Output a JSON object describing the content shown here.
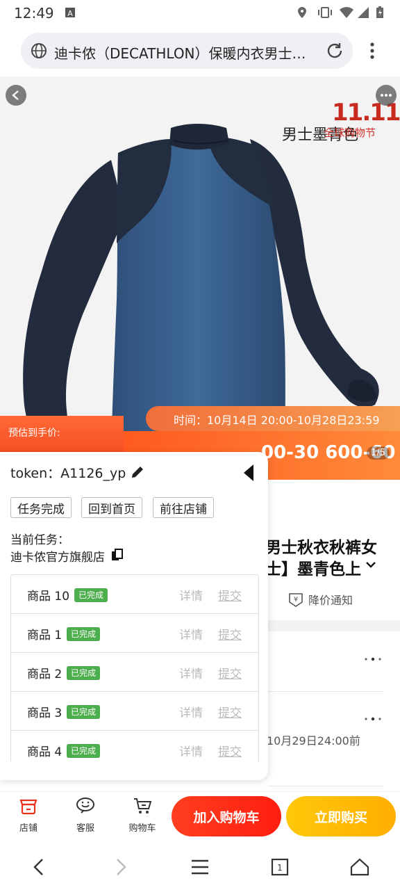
{
  "status_bar": {
    "time": "12:49"
  },
  "browser": {
    "url_title": "迪卡侬（DECATHLON）保暖内衣男士…"
  },
  "hero": {
    "badge": "11.11",
    "color_name": "男士墨青色",
    "badge_sub": "全球购物节",
    "promo_time": "时间：10月14日 20:00-10月28日23:59",
    "promo_label": "预估到手价:",
    "promo_deal": "00-30 600-60",
    "pager": "1/5"
  },
  "product": {
    "title_line1": "男士秋衣秋裤女",
    "title_line2": "士】墨青色上",
    "price_alert": "降价通知",
    "deadline": "10月29日24:00前"
  },
  "panel": {
    "token_label": "token：",
    "token_value": "A1126_yp",
    "buttons": [
      "任务完成",
      "回到首页",
      "前往店铺"
    ],
    "current_task_label": "当前任务：",
    "store_name": "迪卡侬官方旗舰店",
    "status_done": "已完成",
    "detail_label": "详情",
    "submit_label": "提交",
    "tasks": [
      "商品 10",
      "商品 1",
      "商品 2",
      "商品 3",
      "商品 4"
    ]
  },
  "action_bar": {
    "tabs": [
      "店铺",
      "客服",
      "购物车"
    ],
    "add_to_cart": "加入购物车",
    "buy_now": "立即购买"
  },
  "colors": {
    "accent_red": "#ff2a12",
    "accent_yellow": "#ffbb00",
    "done_green": "#4cae4c"
  }
}
